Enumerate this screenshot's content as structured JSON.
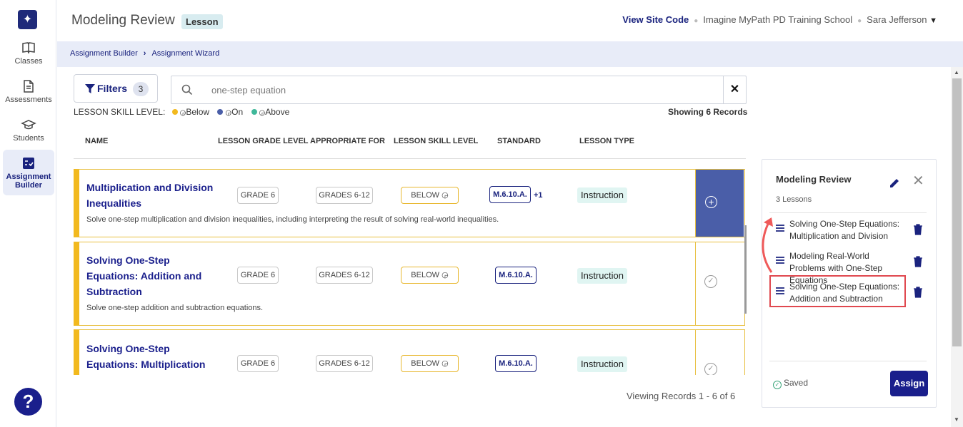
{
  "sidebar": {
    "logo_icon": "sparkle-icon",
    "items": [
      {
        "label": "Classes",
        "icon": "book-icon"
      },
      {
        "label": "Assessments",
        "icon": "document-icon"
      },
      {
        "label": "Students",
        "icon": "graduation-cap-icon"
      },
      {
        "label": "Assignment Builder",
        "icon": "checklist-icon",
        "active": true
      }
    ],
    "help_label": "?"
  },
  "header": {
    "title": "Modeling Review",
    "badge": "Lesson",
    "view_site_code": "View Site Code",
    "school": "Imagine MyPath PD Training School",
    "user": "Sara  Jefferson"
  },
  "breadcrumb": {
    "items": [
      "Assignment Builder",
      "Assignment Wizard"
    ]
  },
  "toolbar": {
    "filters_label": "Filters",
    "filters_count": "3",
    "search_value": "one-step equation",
    "clear_label": "✕"
  },
  "legend": {
    "label": "LESSON SKILL LEVEL:",
    "items": [
      {
        "label": "Below",
        "color": "#f2b91e"
      },
      {
        "label": "On",
        "color": "#4a5ea8"
      },
      {
        "label": "Above",
        "color": "#3fb89a"
      }
    ]
  },
  "records": {
    "showing": "Showing 6 Records",
    "viewing": "Viewing Records 1 - 6 of 6"
  },
  "table": {
    "headers": [
      "NAME",
      "LESSON GRADE LEVEL",
      "APPROPRIATE FOR",
      "LESSON SKILL LEVEL",
      "STANDARD",
      "LESSON TYPE"
    ],
    "rows": [
      {
        "title_lines": [
          "Multiplication and Division",
          "Inequalities"
        ],
        "description": "Solve one-step multiplication and division inequalities, including interpreting the result of solving real-world inequalities.",
        "grade": "GRADE 6",
        "appropriate": "GRADES 6-12",
        "skill": "BELOW",
        "standard": "M.6.10.A.",
        "standard_extra": "+1",
        "type": "Instruction",
        "action": "add"
      },
      {
        "title_lines": [
          "Solving One-Step",
          "Equations: Addition and",
          "Subtraction"
        ],
        "description": "Solve one-step addition and subtraction equations.",
        "grade": "GRADE 6",
        "appropriate": "GRADES 6-12",
        "skill": "BELOW",
        "standard": "M.6.10.A.",
        "standard_extra": "",
        "type": "Instruction",
        "action": "added"
      },
      {
        "title_lines": [
          "Solving One-Step",
          "Equations: Multiplication"
        ],
        "description": "",
        "grade": "GRADE 6",
        "appropriate": "GRADES 6-12",
        "skill": "BELOW",
        "standard": "M.6.10.A.",
        "standard_extra": "",
        "type": "Instruction",
        "action": "added"
      }
    ]
  },
  "panel": {
    "title": "Modeling Review",
    "subtitle": "3 Lessons",
    "items": [
      {
        "label": "Solving One-Step Equations: Multiplication and Division"
      },
      {
        "label": "Modeling Real-World Problems with One-Step Equations"
      },
      {
        "label": "Solving One-Step Equations: Addition and Subtraction"
      }
    ],
    "saved_label": "Saved",
    "assign_label": "Assign"
  },
  "colors": {
    "brand_navy": "#1a1f8c",
    "below_yellow": "#f2b91e",
    "highlight_red": "#e0484f"
  }
}
